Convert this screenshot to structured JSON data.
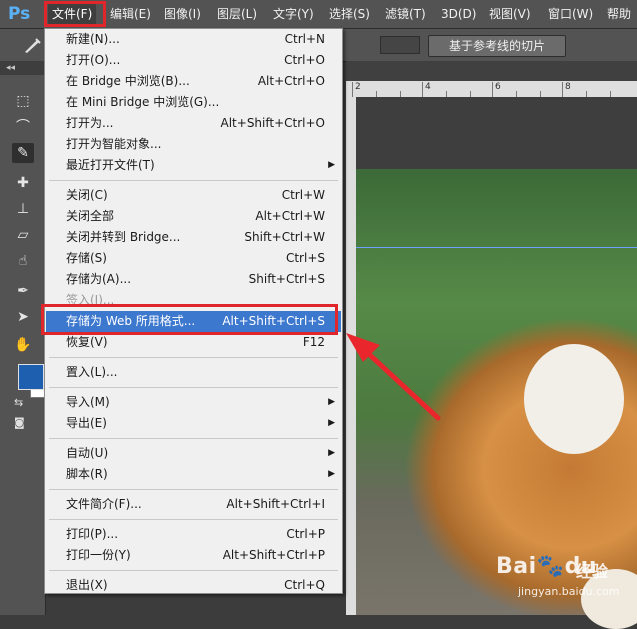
{
  "app": {
    "logo": "Ps"
  },
  "menubar": {
    "items": [
      "文件(F)",
      "编辑(E)",
      "图像(I)",
      "图层(L)",
      "文字(Y)",
      "选择(S)",
      "滤镜(T)",
      "3D(D)",
      "视图(V)",
      "窗口(W)",
      "帮助"
    ],
    "active_index": 0
  },
  "options_bar": {
    "slice_button_label": "基于参考线的切片",
    "tool_icon": "slice-tool-icon"
  },
  "toolbox": {
    "grip": "◂◂",
    "foreground_color": "#1f5fb0",
    "background_color": "#ffffff",
    "tools": [
      "marquee-icon",
      "lasso-icon",
      "slice-icon",
      "healing-brush-icon",
      "stamp-icon",
      "eraser-icon",
      "smudge-icon",
      "pen-icon",
      "path-select-icon",
      "hand-icon"
    ]
  },
  "ruler": {
    "labels": [
      "2",
      "4",
      "6",
      "8"
    ]
  },
  "file_menu": {
    "items": [
      {
        "label": "新建(N)...",
        "shortcut": "Ctrl+N"
      },
      {
        "label": "打开(O)...",
        "shortcut": "Ctrl+O"
      },
      {
        "label": "在 Bridge 中浏览(B)...",
        "shortcut": "Alt+Ctrl+O"
      },
      {
        "label": "在 Mini Bridge 中浏览(G)...",
        "shortcut": ""
      },
      {
        "label": "打开为...",
        "shortcut": "Alt+Shift+Ctrl+O"
      },
      {
        "label": "打开为智能对象...",
        "shortcut": ""
      },
      {
        "label": "最近打开文件(T)",
        "shortcut": "",
        "submenu": true
      },
      {
        "label": "关闭(C)",
        "shortcut": "Ctrl+W"
      },
      {
        "label": "关闭全部",
        "shortcut": "Alt+Ctrl+W"
      },
      {
        "label": "关闭并转到 Bridge...",
        "shortcut": "Shift+Ctrl+W"
      },
      {
        "label": "存储(S)",
        "shortcut": "Ctrl+S"
      },
      {
        "label": "存储为(A)...",
        "shortcut": "Shift+Ctrl+S"
      },
      {
        "label": "签入(I)...",
        "shortcut": "",
        "disabled": true
      },
      {
        "label": "存储为 Web 所用格式...",
        "shortcut": "Alt+Shift+Ctrl+S",
        "highlighted": true
      },
      {
        "label": "恢复(V)",
        "shortcut": "F12"
      },
      {
        "label": "置入(L)...",
        "shortcut": ""
      },
      {
        "label": "导入(M)",
        "shortcut": "",
        "submenu": true
      },
      {
        "label": "导出(E)",
        "shortcut": "",
        "submenu": true
      },
      {
        "label": "自动(U)",
        "shortcut": "",
        "submenu": true
      },
      {
        "label": "脚本(R)",
        "shortcut": "",
        "submenu": true
      },
      {
        "label": "文件简介(F)...",
        "shortcut": "Alt+Shift+Ctrl+I"
      },
      {
        "label": "打印(P)...",
        "shortcut": "Ctrl+P"
      },
      {
        "label": "打印一份(Y)",
        "shortcut": "Alt+Shift+Ctrl+P"
      },
      {
        "label": "退出(X)",
        "shortcut": "Ctrl+Q"
      }
    ],
    "separators_after": [
      6,
      14,
      15,
      17,
      19,
      20,
      22
    ]
  },
  "annotations": {
    "highlight_color": "#e0262b",
    "arrow_color": "#e8262b"
  },
  "watermark": {
    "brand": "Bai",
    "brand_suffix": "du",
    "jingyan": "经验",
    "url": "jingyan.baidu.com"
  }
}
